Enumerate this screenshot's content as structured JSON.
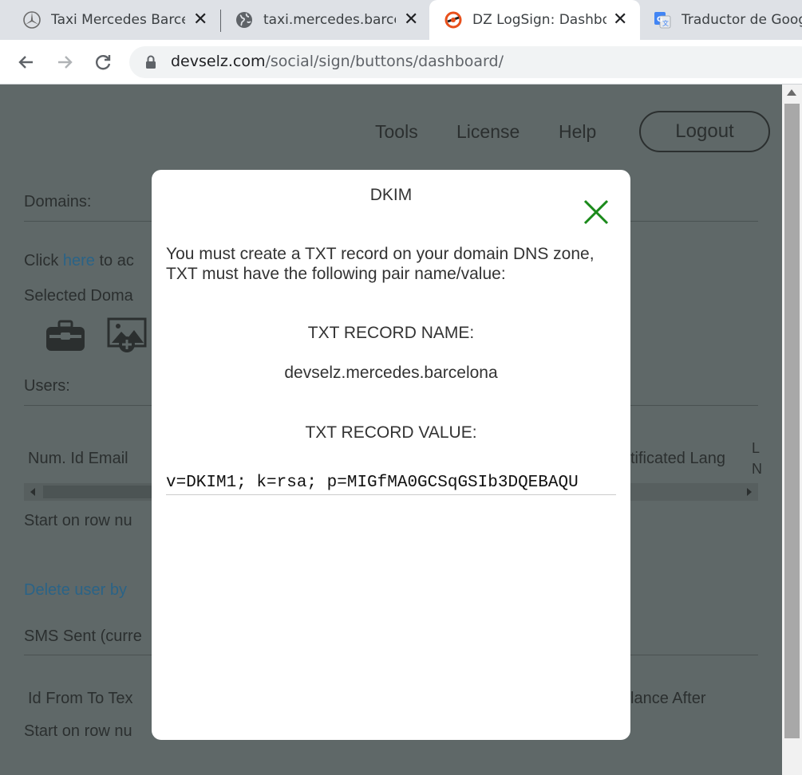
{
  "tabs": [
    {
      "title": "Taxi Mercedes Barcelona",
      "icon": "mercedes-logo-icon"
    },
    {
      "title": "taxi.mercedes.barcelona",
      "icon": "globe-icon"
    },
    {
      "title": "DZ LogSign: Dashboard",
      "icon": "dz-logsign-icon"
    },
    {
      "title": "Traductor de Google",
      "icon": "google-translate-icon"
    }
  ],
  "address": {
    "host": "devselz.com",
    "path": "/social/sign/buttons/dashboard/"
  },
  "nav": {
    "tools": "Tools",
    "license": "License",
    "help": "Help",
    "logout": "Logout"
  },
  "page": {
    "domains_label": "Domains:",
    "click_prefix": "Click ",
    "click_link": "here",
    "click_suffix": " to ac",
    "selected_domain": "Selected Doma",
    "users_label": "Users:",
    "users_columns_left": "Num. Id Email",
    "users_columns_right": "tificated Lang",
    "users_col_edge_1": "L",
    "users_col_edge_2": "N",
    "start_row_1": "Start on row nu",
    "delete_user": "Delete user by",
    "sms_sent": "SMS Sent (curre",
    "sms_columns_left": "Id From To Tex",
    "sms_columns_right": "lance After",
    "start_row_2": "Start on row nu"
  },
  "modal": {
    "title": "DKIM",
    "description": "You must create a TXT record on your domain DNS zone, TXT must have the following pair name/value:",
    "record_name_label": "TXT RECORD NAME:",
    "record_name_value": "devselz.mercedes.barcelona",
    "record_value_label": "TXT RECORD VALUE:",
    "record_value": "v=DKIM1; k=rsa; p=MIGfMA0GCSqGSIb3DQEBAQU"
  },
  "colors": {
    "close_x": "#1a8a1a",
    "link": "#2a6387",
    "overlay": "#5f6868"
  }
}
